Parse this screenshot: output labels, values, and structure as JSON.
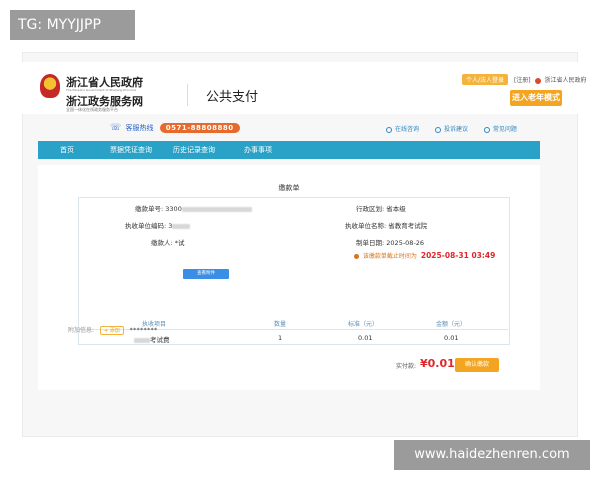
{
  "watermarks": {
    "top": "TG: MYYJJPP",
    "bottom": "www.haidezhenren.com"
  },
  "header": {
    "org_name_1": "浙江省人民政府",
    "org_name_en": "The People's Government of Zhejiang Province",
    "org_name_2": "浙江政务服务网",
    "org_slogan": "全国一体化在线政务服务平台",
    "page_heading": "公共支付",
    "login_label": "个人/法人登录",
    "register_label": "[注册]",
    "region_label": "浙江省人民政府",
    "elder_mode_label": "进入老年模式"
  },
  "hotline": {
    "label": "客服热线",
    "number": "0571-88808880"
  },
  "quick_links": [
    {
      "label": "在线咨询",
      "icon": "chat-icon"
    },
    {
      "label": "投诉建议",
      "icon": "message-icon"
    },
    {
      "label": "常见问题",
      "icon": "question-icon"
    }
  ],
  "nav": {
    "items": [
      "首页",
      "票据凭证查询",
      "历史记录查询",
      "办事事项"
    ]
  },
  "panel": {
    "title": "缴款单",
    "fields": {
      "bill_no_label": "缴款单号:",
      "bill_no_value": "3300",
      "region_label": "行政区划:",
      "region_value": "省本级",
      "unit_code_label": "执收单位编码:",
      "unit_code_value": "3",
      "unit_name_label": "执收单位名称:",
      "unit_name_value": "省教育考试院",
      "payer_label": "缴款人:",
      "payer_value": "*试",
      "date_label": "制单日期:",
      "date_value": "2025-08-26"
    },
    "deadline_label": "该缴款单截止时间为",
    "deadline_value": "2025-08-31 03:49",
    "detail_button": "查看附件",
    "table": {
      "headers": [
        "执收项目",
        "数量",
        "标准（元）",
        "金额（元）"
      ],
      "rows": [
        {
          "item": "考试费",
          "qty": "1",
          "standard": "0.01",
          "amount": "0.01"
        }
      ]
    },
    "extra_label": "附加信息:",
    "extra_tag": "+ 添加",
    "extra_value": "********"
  },
  "payment": {
    "total_label": "实付款:",
    "total_value": "¥0.01",
    "confirm_label": "确认缴款"
  },
  "colors": {
    "nav_bg": "#2aa2c8",
    "accent_orange": "#f3a521",
    "alert_red": "#e0262a",
    "link_blue": "#2a64c6"
  }
}
